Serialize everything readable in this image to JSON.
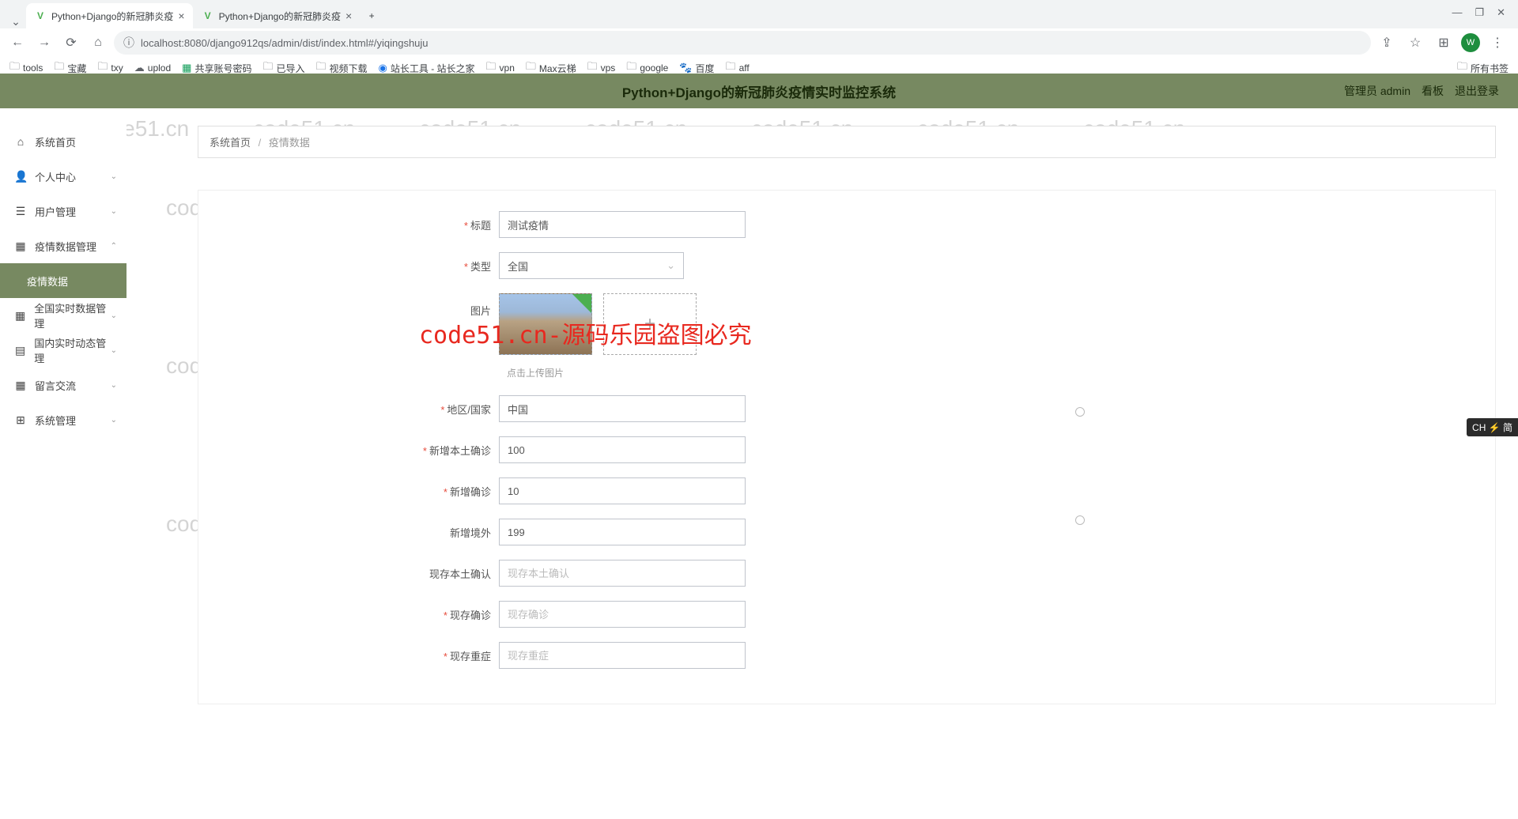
{
  "browser": {
    "tabs": [
      {
        "title": "Python+Django的新冠肺炎疫",
        "active": true
      },
      {
        "title": "Python+Django的新冠肺炎疫",
        "active": false
      }
    ],
    "url": "localhost:8080/django912qs/admin/dist/index.html#/yiqingshuju",
    "avatar": "W",
    "bookmarks": [
      "tools",
      "宝藏",
      "txy",
      "uplod",
      "共享账号密码",
      "已导入",
      "视频下载",
      "站长工具 - 站长之家",
      "vpn",
      "Max云梯",
      "vps",
      "google",
      "百度",
      "aff"
    ],
    "all_bookmarks": "所有书签"
  },
  "window_controls": {
    "min": "—",
    "max": "❐",
    "close": "✕"
  },
  "header": {
    "title": "Python+Django的新冠肺炎疫情实时监控系统",
    "user": "管理员 admin",
    "dashboard": "看板",
    "logout": "退出登录"
  },
  "sidebar": {
    "items": [
      {
        "icon": "home",
        "label": "系统首页"
      },
      {
        "icon": "user",
        "label": "个人中心",
        "expandable": true
      },
      {
        "icon": "menu",
        "label": "用户管理",
        "expandable": true
      },
      {
        "icon": "grid",
        "label": "疫情数据管理",
        "expandable": true,
        "expanded": true
      },
      {
        "icon": "",
        "label": "疫情数据",
        "active": true
      },
      {
        "icon": "grid",
        "label": "全国实时数据管理",
        "expandable": true
      },
      {
        "icon": "doc",
        "label": "国内实时动态管理",
        "expandable": true
      },
      {
        "icon": "grid2",
        "label": "留言交流",
        "expandable": true
      },
      {
        "icon": "grid3",
        "label": "系统管理",
        "expandable": true
      }
    ]
  },
  "breadcrumb": {
    "home": "系统首页",
    "current": "疫情数据"
  },
  "form": {
    "title_label": "标题",
    "title_value": "测试疫情",
    "type_label": "类型",
    "type_value": "全国",
    "image_label": "图片",
    "upload_hint": "点击上传图片",
    "region_label": "地区/国家",
    "region_value": "中国",
    "local_new_label": "新增本土确诊",
    "local_new_value": "100",
    "new_confirm_label": "新增确诊",
    "new_confirm_value": "10",
    "new_abroad_label": "新增境外",
    "new_abroad_value": "199",
    "exist_local_label": "现存本土确认",
    "exist_local_placeholder": "现存本土确认",
    "exist_confirm_label": "现存确诊",
    "exist_confirm_placeholder": "现存确诊",
    "exist_severe_label": "现存重症",
    "exist_severe_placeholder": "现存重症"
  },
  "watermark_text": "code51.cn",
  "overlay": "code51.cn-源码乐园盗图必究",
  "ime": "CH ⚡ 简"
}
